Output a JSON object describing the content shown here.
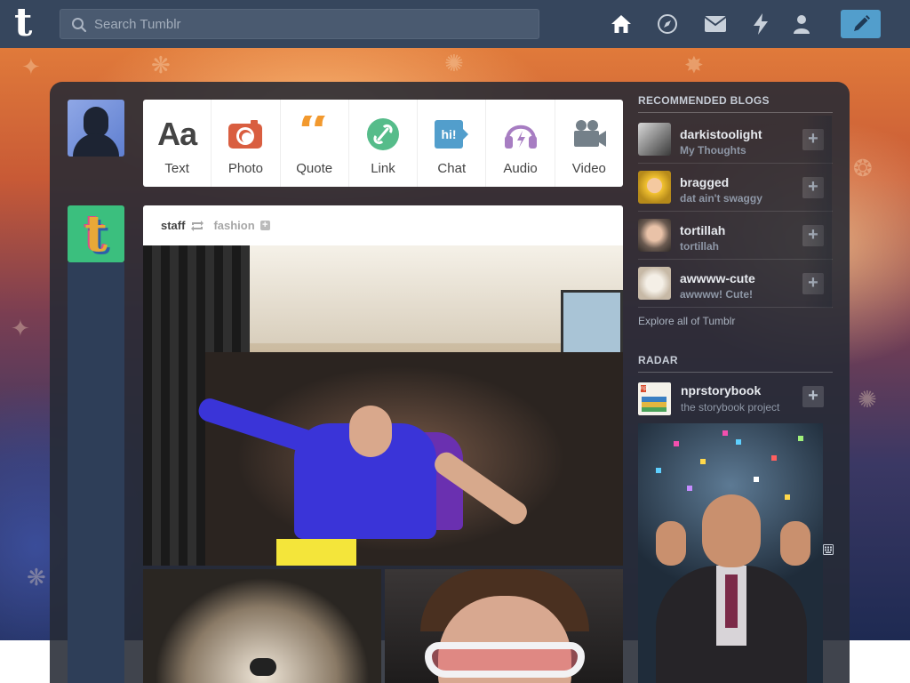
{
  "header": {
    "search_placeholder": "Search Tumblr",
    "nav_icons": [
      "home-icon",
      "explore-icon",
      "mail-icon",
      "activity-icon",
      "account-icon"
    ],
    "compose_icon": "pencil-icon"
  },
  "post_types": [
    {
      "label": "Text",
      "icon": "text-icon",
      "color": "#444444"
    },
    {
      "label": "Photo",
      "icon": "camera-icon",
      "color": "#d95e40"
    },
    {
      "label": "Quote",
      "icon": "quote-icon",
      "color": "#f2992e"
    },
    {
      "label": "Link",
      "icon": "link-icon",
      "color": "#56bc8a"
    },
    {
      "label": "Chat",
      "icon": "chat-icon",
      "color": "#529ecc"
    },
    {
      "label": "Audio",
      "icon": "headphones-icon",
      "color": "#a77dc2"
    },
    {
      "label": "Video",
      "icon": "video-camera-icon",
      "color": "#748089"
    }
  ],
  "post": {
    "author": "staff",
    "reblogged_from": "fashion"
  },
  "sidebar": {
    "recommended_title": "RECOMMENDED BLOGS",
    "blogs": [
      {
        "name": "darkistoolight",
        "desc": "My Thoughts"
      },
      {
        "name": "bragged",
        "desc": "dat ain't swaggy"
      },
      {
        "name": "tortillah",
        "desc": "tortillah"
      },
      {
        "name": "awwww-cute",
        "desc": "awwww! Cute!"
      }
    ],
    "explore": "Explore all of Tumblr",
    "radar_title": "RADAR",
    "radar": {
      "name": "nprstorybook",
      "desc": "the storybook project",
      "logo": "npr"
    }
  },
  "colors": {
    "header_bg": "#36465d",
    "compose_bg": "#529ecc",
    "dashboard_bg": "#262a34"
  }
}
